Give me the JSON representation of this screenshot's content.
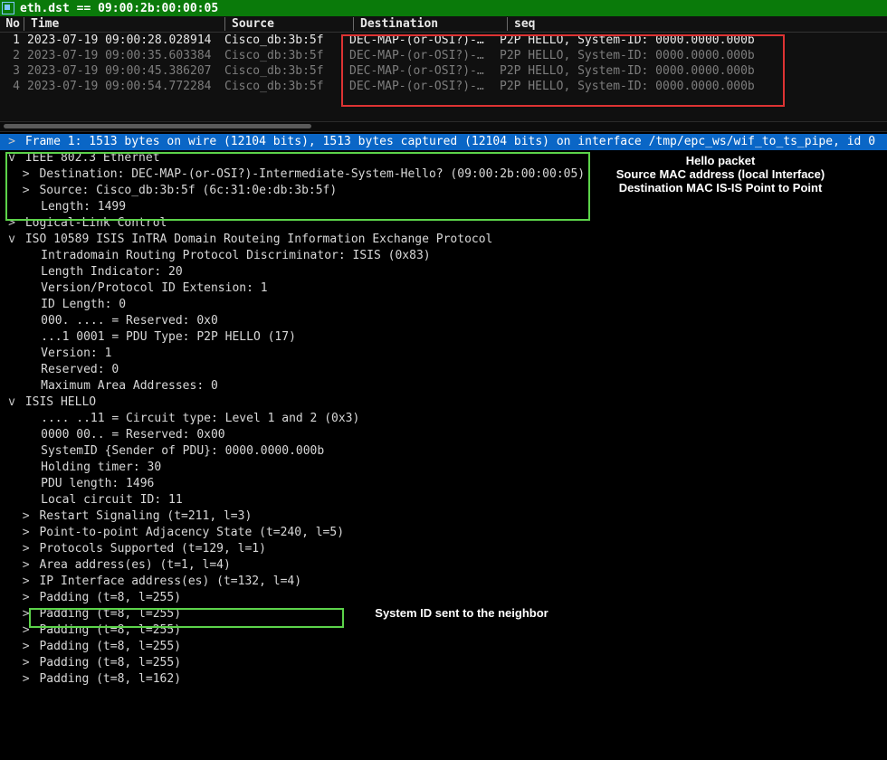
{
  "filter": "eth.dst == 09:00:2b:00:00:05",
  "columns": {
    "no": "No",
    "time": "Time",
    "src": "Source",
    "dst": "Destination",
    "seq": "seq"
  },
  "packets": [
    {
      "no": "1",
      "time": "2023-07-19 09:00:28.028914",
      "src": "Cisco_db:3b:5f",
      "dst": "DEC-MAP-(or-OSI?)-…",
      "info": "P2P HELLO, System-ID: 0000.0000.000b",
      "sel": true
    },
    {
      "no": "2",
      "time": "2023-07-19 09:00:35.603384",
      "src": "Cisco_db:3b:5f",
      "dst": "DEC-MAP-(or-OSI?)-…",
      "info": "P2P HELLO, System-ID: 0000.0000.000b",
      "sel": false
    },
    {
      "no": "3",
      "time": "2023-07-19 09:00:45.386207",
      "src": "Cisco_db:3b:5f",
      "dst": "DEC-MAP-(or-OSI?)-…",
      "info": "P2P HELLO, System-ID: 0000.0000.000b",
      "sel": false
    },
    {
      "no": "4",
      "time": "2023-07-19 09:00:54.772284",
      "src": "Cisco_db:3b:5f",
      "dst": "DEC-MAP-(or-OSI?)-…",
      "info": "P2P HELLO, System-ID: 0000.0000.000b",
      "sel": false
    }
  ],
  "frame_line": "Frame 1: 1513 bytes on wire (12104 bits), 1513 bytes captured (12104 bits) on interface /tmp/epc_ws/wif_to_ts_pipe, id 0",
  "eth": {
    "title": "IEEE 802.3 Ethernet",
    "dst": "Destination: DEC-MAP-(or-OSI?)-Intermediate-System-Hello? (09:00:2b:00:00:05)",
    "src": "Source: Cisco_db:3b:5f (6c:31:0e:db:3b:5f)",
    "len": "Length: 1499"
  },
  "llc": "Logical-Link Control",
  "iso": {
    "title": "ISO 10589 ISIS InTRA Domain Routeing Information Exchange Protocol",
    "f1": "Intradomain Routing Protocol Discriminator: ISIS (0x83)",
    "f2": "Length Indicator: 20",
    "f3": "Version/Protocol ID Extension: 1",
    "f4": "ID Length: 0",
    "f5": "000. .... = Reserved: 0x0",
    "f6": "...1 0001 = PDU Type: P2P HELLO (17)",
    "f7": "Version: 1",
    "f8": "Reserved: 0",
    "f9": "Maximum Area Addresses: 0"
  },
  "hello": {
    "title": "ISIS HELLO",
    "f1": ".... ..11 = Circuit type: Level 1 and 2 (0x3)",
    "f2": "0000 00.. = Reserved: 0x00",
    "f3": "SystemID {Sender of PDU}: 0000.0000.000b",
    "f4": "Holding timer: 30",
    "f5": "PDU length: 1496",
    "f6": "Local circuit ID: 11",
    "s1": "Restart Signaling (t=211, l=3)",
    "s2": "Point-to-point Adjacency State (t=240, l=5)",
    "s3": "Protocols Supported (t=129, l=1)",
    "s4": "Area address(es) (t=1, l=4)",
    "s5": "IP Interface address(es) (t=132, l=4)",
    "p1": "Padding (t=8, l=255)",
    "p2": "Padding (t=8, l=255)",
    "p3": "Padding (t=8, l=255)",
    "p4": "Padding (t=8, l=255)",
    "p5": "Padding (t=8, l=255)",
    "p6": "Padding (t=8, l=162)"
  },
  "annot": {
    "right_l1": "Hello packet",
    "right_l2": "Source MAC address (local Interface)",
    "right_l3": "Destination MAC IS-IS Point to Point",
    "mid": "System ID  sent to the neighbor"
  }
}
